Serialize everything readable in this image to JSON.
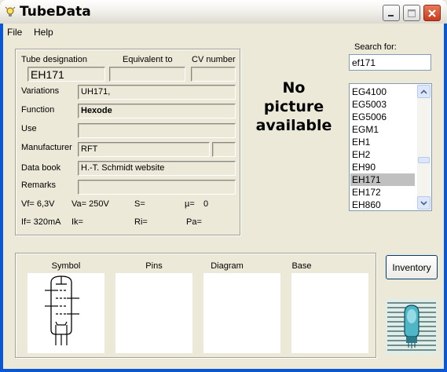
{
  "window": {
    "title": "TubeData",
    "accent": "#0a57d4"
  },
  "menu": {
    "file": "File",
    "help": "Help"
  },
  "fields": {
    "designation_label": "Tube designation",
    "designation_value": "EH171",
    "equivalent_label": "Equivalent to",
    "equivalent_value": "",
    "cv_label": "CV number",
    "cv_value": "",
    "variations_label": "Variations",
    "variations_value": "UH171,",
    "function_label": "Function",
    "function_value": "Hexode",
    "use_label": "Use",
    "use_value": "",
    "manufacturer_label": "Manufacturer",
    "manufacturer_value": "RFT",
    "manufacturer_extra": "",
    "databook_label": "Data book",
    "databook_value": "H.-T. Schmidt website",
    "remarks_label": "Remarks",
    "remarks_value": ""
  },
  "specs": {
    "vf": "Vf= 6,3V",
    "va": "Va= 250V",
    "s": "S=",
    "mu": "µ=",
    "mu_value": "0",
    "if": "If= 320mA",
    "ik": "Ik=",
    "ri": "Ri=",
    "pa": "Pa="
  },
  "picture": {
    "line1": "No",
    "line2": "picture",
    "line3": "available"
  },
  "search": {
    "label": "Search for:",
    "value": "ef171"
  },
  "tube_list": {
    "items": [
      "EG4100",
      "EG5003",
      "EG5006",
      "EGM1",
      "EH1",
      "EH2",
      "EH90",
      "EH171",
      "EH172",
      "EH860"
    ],
    "selected": "EH171"
  },
  "bottom": {
    "symbol": "Symbol",
    "pins": "Pins",
    "diagram": "Diagram",
    "base": "Base"
  },
  "inventory_button": "Inventory",
  "icons": {
    "app": "lightbulb-icon",
    "minimize": "minimize-icon",
    "maximize": "maximize-icon",
    "close": "close-icon"
  }
}
